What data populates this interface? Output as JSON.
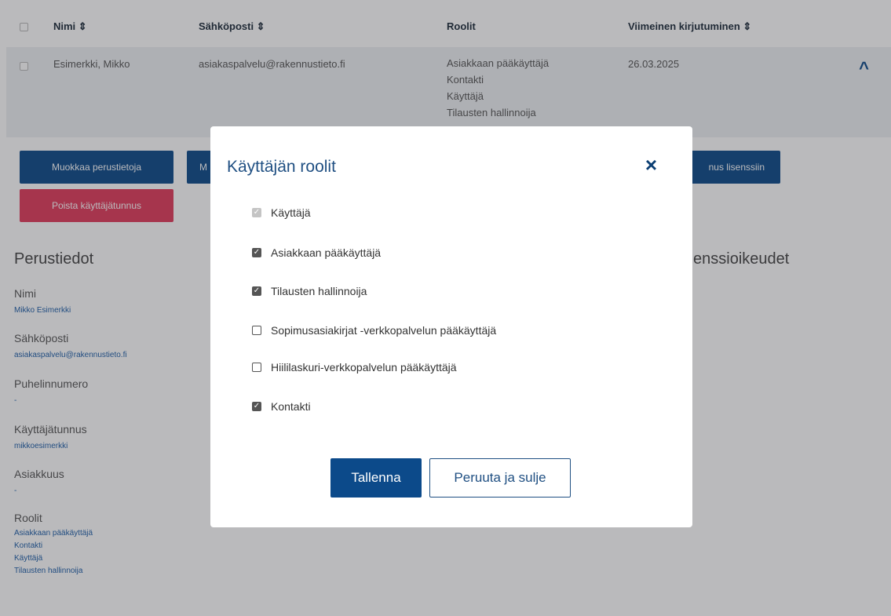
{
  "table": {
    "headers": {
      "name": "Nimi ⇕",
      "email": "Sähköposti ⇕",
      "roles": "Roolit",
      "last_login": "Viimeinen kirjutuminen ⇕"
    },
    "row": {
      "name": "Esimerkki, Mikko",
      "email": "asiakaspalvelu@rakennustieto.fi",
      "roles": [
        "Asiakkaan pääkäyttäjä",
        "Kontakti",
        "Käyttäjä",
        "Tilausten hallinnoija"
      ],
      "last_login": "26.03.2025"
    }
  },
  "actions": {
    "edit_basic": "Muokkaa perustietoja",
    "edit_partial": "M",
    "license_partial": "nus lisenssiin",
    "delete_user": "Poista käyttäjätunnus"
  },
  "details": {
    "section_title": "Perustiedot",
    "right_section_title_partial": "enssioikeudet",
    "name_label": "Nimi",
    "name_value": "Mikko Esimerkki",
    "email_label": "Sähköposti",
    "email_value": "asiakaspalvelu@rakennustieto.fi",
    "phone_label": "Puhelinnumero",
    "phone_value": "-",
    "username_label": "Käyttäjätunnus",
    "username_value": "mikkoesimerkki",
    "customer_label": "Asiakkuus",
    "customer_value": "-",
    "roles_label": "Roolit",
    "roles_values": [
      "Asiakkaan pääkäyttäjä",
      "Kontakti",
      "Käyttäjä",
      "Tilausten hallinnoija"
    ]
  },
  "modal": {
    "title": "Käyttäjän roolit",
    "close_icon": "×",
    "options": [
      {
        "label": "Käyttäjä",
        "checked": true,
        "disabled": true
      },
      {
        "label": "Asiakkaan pääkäyttäjä",
        "checked": true,
        "disabled": false
      },
      {
        "label": "Tilausten hallinnoija",
        "checked": true,
        "disabled": false
      },
      {
        "label": "Sopimusasiakirjat -verkkopalvelun pääkäyttäjä",
        "checked": false,
        "disabled": false
      },
      {
        "label": "Hiililaskuri-verkkopalvelun pääkäyttäjä",
        "checked": false,
        "disabled": false
      },
      {
        "label": "Kontakti",
        "checked": true,
        "disabled": false
      }
    ],
    "save_label": "Tallenna",
    "cancel_label": "Peruuta ja sulje"
  },
  "colors": {
    "primary": "#0c4a8a",
    "danger": "#e23b5c",
    "overlay": "#282830"
  }
}
